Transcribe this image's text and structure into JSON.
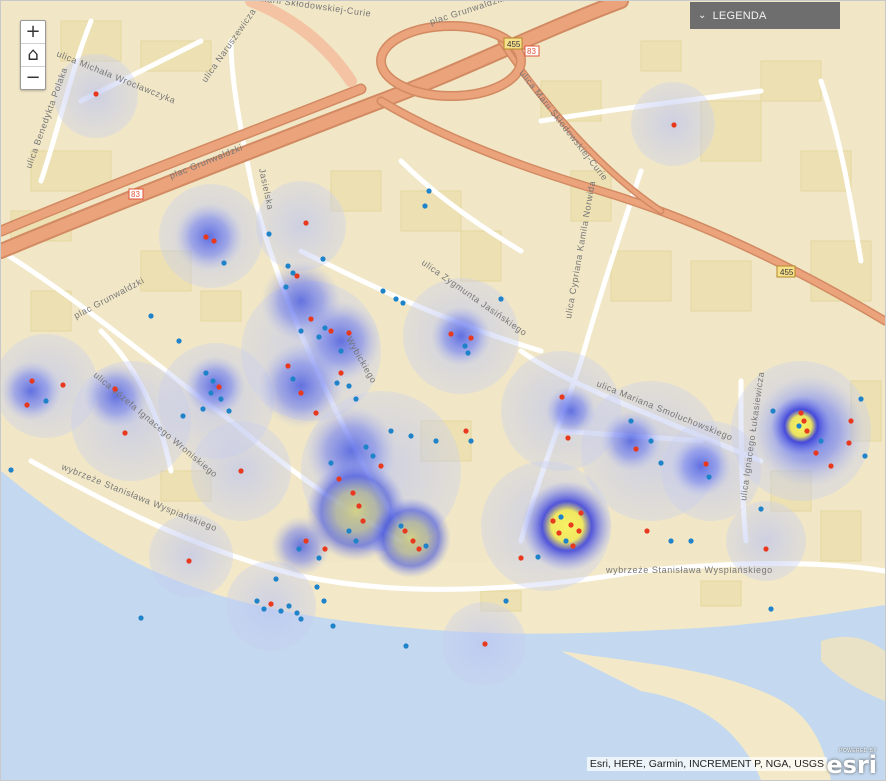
{
  "legend": {
    "label": "LEGENDA"
  },
  "zoom": {
    "in": "+",
    "home": "⌂",
    "out": "−"
  },
  "attribution": "Esri, HERE, Garmin, INCREMENT P, NGA, USGS",
  "esri_logo": {
    "powered": "POWERED BY",
    "brand": "esri"
  },
  "streets": [
    "plac Grunwaldzki",
    "plac Grunwaldzki",
    "ulica Marii Skłodowskiej-Curie",
    "Marii Skłodowskiej-Curie",
    "ulica Michała Wrocławczyka",
    "ulica Naruszewicza",
    "ulica Benedykta Polaka",
    "plac Grunwaldzki",
    "ulica Józefa Ignacego Wroniskiego",
    "ulica Zygmunta Jasińskiego",
    "ulica Cypriana Kamila Norwida",
    "ulica Mariana Smoluchowskiego",
    "ulica Ignacego Łukasiewicza",
    "wybrzeże Stanisława Wyspiańskiego",
    "wybrzeże Stanisława Wyspiańskiego",
    "Jasielska",
    "Wybickiego"
  ],
  "road_shields": [
    "455",
    "455",
    "83",
    "83"
  ],
  "colors": {
    "heat_low": "#6f7cf2",
    "heat_mid": "#3a4bd6",
    "heat_high": "#f5ef5a",
    "point_red": "#e8391f",
    "point_blue": "#1f83c9",
    "water": "#c4d9ef",
    "land": "#f3e9c8",
    "road_major": "#e99a6f"
  }
}
